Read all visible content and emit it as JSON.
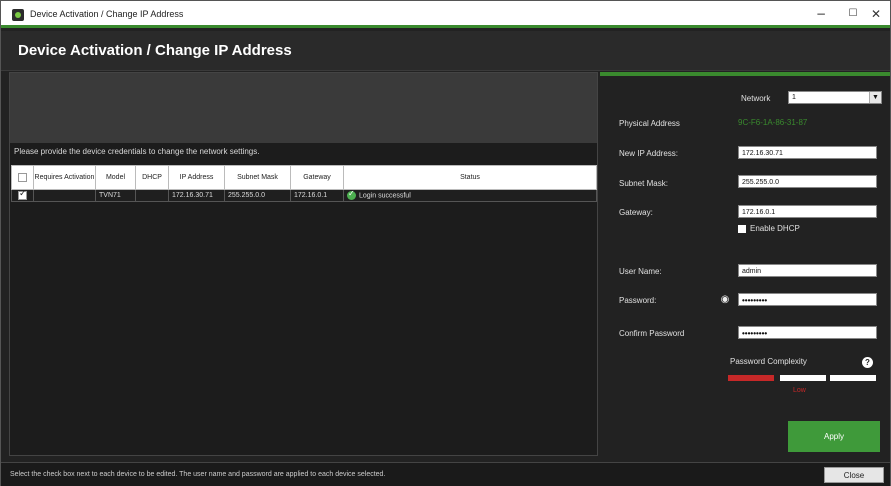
{
  "window": {
    "title": "Device Activation / Change IP Address",
    "min": "−",
    "max": "☐",
    "close": "✕"
  },
  "header": {
    "title": "Device Activation / Change IP Address"
  },
  "left": {
    "info": "Please provide the device credentials to change the network settings.",
    "columns": [
      "",
      "Requires Activation",
      "Model",
      "DHCP",
      "IP Address",
      "Subnet Mask",
      "Gateway",
      "Status"
    ],
    "rows": [
      {
        "checked": true,
        "requires_activation": "",
        "model": "TVN71",
        "dhcp": "",
        "ip": "172.16.30.71",
        "subnet": "255.255.0.0",
        "gateway": "172.16.0.1",
        "status": "Login successful"
      }
    ]
  },
  "right": {
    "network_label": "Network",
    "network_value": "1",
    "physical_address_label": "Physical Address",
    "physical_address": "9C-F6-1A-86-31-87",
    "new_ip_label": "New IP Address:",
    "new_ip": "172.16.30.71",
    "subnet_label": "Subnet Mask:",
    "subnet": "255.255.0.0",
    "gateway_label": "Gateway:",
    "gateway": "172.16.0.1",
    "enable_dhcp": "Enable DHCP",
    "username_label": "User Name:",
    "username": "admin",
    "password_label": "Password:",
    "password": "•••••••••",
    "confirm_label": "Confirm Password",
    "confirm": "•••••••••",
    "complexity_label": "Password Complexity",
    "complexity_help": "?",
    "complexity_value": "Low",
    "apply": "Apply"
  },
  "footer": {
    "message": "Select the check box next to each device to be edited. The user name and password are applied to each device selected.",
    "close": "Close"
  },
  "colors": {
    "accent": "#3a8a2e",
    "low": "#c62828"
  }
}
